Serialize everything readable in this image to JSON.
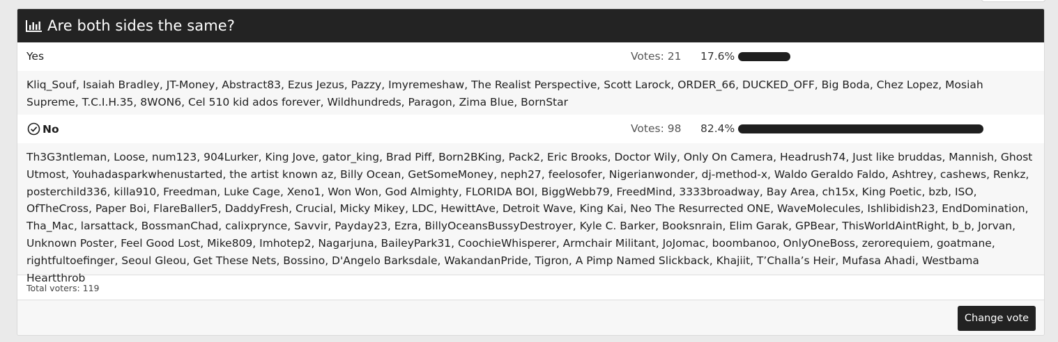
{
  "poll": {
    "title": "Are both sides the same?",
    "options": [
      {
        "label": "Yes",
        "votes_text": "Votes: 21",
        "percent_text": "17.6%",
        "percent": 17.6,
        "selected": false,
        "voters": [
          "Kliq_Souf",
          "Isaiah Bradley",
          "JT-Money",
          "Abstract83",
          "Ezus Jezus",
          "Pazzy",
          "Imyremeshaw",
          "The Realist Perspective",
          "Scott Larock",
          "ORDER_66",
          "DUCKED_OFF",
          "Big Boda",
          "Chez Lopez",
          "Mosiah Supreme",
          "T.C.I.H.35",
          "8WON6",
          "Cel 510 kid ados forever",
          "Wildhundreds",
          "Paragon",
          "Zima Blue",
          "BornStar"
        ]
      },
      {
        "label": "No",
        "votes_text": "Votes: 98",
        "percent_text": "82.4%",
        "percent": 82.4,
        "selected": true,
        "voters": [
          "Th3G3ntleman",
          "Loose",
          "num123",
          "904Lurker",
          "King Jove",
          "gator_king",
          "Brad Piff",
          "Born2BKing",
          "Pack2",
          "Eric Brooks",
          "Doctor Wily",
          "Only On Camera",
          "Headrush74",
          "Just like bruddas",
          "Mannish",
          "Ghost Utmost",
          "Youhadasparkwhenustarted",
          "the artist known az",
          "Billy Ocean",
          "GetSomeMoney",
          "neph27",
          "feelosofer",
          "Nigerianwonder",
          "dj-method-x",
          "Waldo Geraldo Faldo",
          "Ashtrey",
          "cashews",
          "Renkz",
          "posterchild336",
          "killa910",
          "Freedman",
          "Luke Cage",
          "Xeno1",
          "Won Won",
          "God Almighty",
          "FLORIDA BOI",
          "BiggWebb79",
          "FreedMind",
          "3333broadway",
          "Bay Area",
          "ch15x",
          "King Poetic",
          "bzb",
          "ISO",
          "OfTheCross",
          "Paper Boi",
          "FlareBaller5",
          "DaddyFresh",
          "Crucial",
          "Micky Mikey",
          "LDC",
          "HewittAve",
          "Detroit Wave",
          "King Kai",
          "Neo The Resurrected ONE",
          "WaveMolecules",
          "Ishlibidish23",
          "EndDomination",
          "Tha_Mac",
          "larsattack",
          "BossmanChad",
          "calixprynce",
          "Savvir",
          "Payday23",
          "Ezra",
          "BillyOceansBussyDestroyer",
          "Kyle C. Barker",
          "Booksnrain",
          "Elim Garak",
          "GPBear",
          "ThisWorldAintRight",
          "b_b",
          "Jorvan",
          "Unknown Poster",
          "Feel Good Lost",
          "Mike809",
          "Imhotep2",
          "Nagarjuna",
          "BaileyPark31",
          "CoochieWhisperer",
          "Armchair Militant",
          "JoJomac",
          "boombanoo",
          "OnlyOneBoss",
          "zerorequiem",
          "goatmane",
          "rightfultoefinger",
          "Seoul Gleou",
          "Get These Nets",
          "Bossino",
          "D'Angelo Barksdale",
          "WakandanPride",
          "Tigron",
          "A Pimp Named Slickback",
          "Khajiit",
          "T’Challa’s Heir",
          "Mufasa Ahadi",
          "Westbama Heartthrob"
        ]
      }
    ],
    "total_voters": "Total voters: 119",
    "change_vote_label": "Change vote",
    "icons": {
      "header": "bar-chart-icon",
      "selected": "check-circle-icon"
    },
    "colors": {
      "header_bg": "#232323",
      "bar": "#1f1f1f",
      "button_bg": "#222222"
    }
  }
}
